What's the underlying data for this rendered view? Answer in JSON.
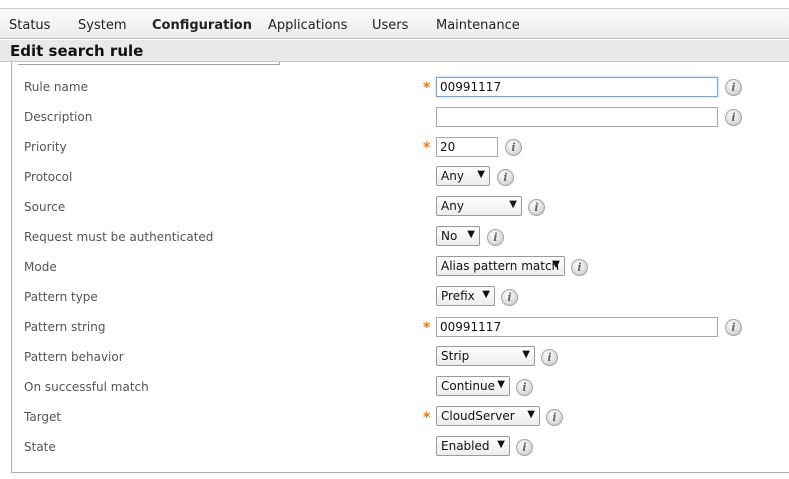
{
  "nav": {
    "items": [
      {
        "label": "Status"
      },
      {
        "label": "System"
      },
      {
        "label": "Configuration"
      },
      {
        "label": "Applications"
      },
      {
        "label": "Users"
      },
      {
        "label": "Maintenance"
      }
    ],
    "active": "Configuration"
  },
  "page": {
    "title": "Edit search rule"
  },
  "icons": {
    "info": "i",
    "required": "*",
    "dropdown": "▼"
  },
  "form": {
    "rule_name": {
      "label": "Rule name",
      "value": "00991117",
      "required": true
    },
    "description": {
      "label": "Description",
      "value": ""
    },
    "priority": {
      "label": "Priority",
      "value": "20",
      "required": true
    },
    "protocol": {
      "label": "Protocol",
      "selected": "Any"
    },
    "source": {
      "label": "Source",
      "selected": "Any"
    },
    "request_auth": {
      "label": "Request must be authenticated",
      "selected": "No"
    },
    "mode": {
      "label": "Mode",
      "selected": "Alias pattern match"
    },
    "pattern_type": {
      "label": "Pattern type",
      "selected": "Prefix"
    },
    "pattern_string": {
      "label": "Pattern string",
      "value": "00991117",
      "required": true
    },
    "pattern_behavior": {
      "label": "Pattern behavior",
      "selected": "Strip"
    },
    "on_success": {
      "label": "On successful match",
      "selected": "Continue"
    },
    "target": {
      "label": "Target",
      "selected": "CloudServer",
      "required": true
    },
    "state": {
      "label": "State",
      "selected": "Enabled"
    }
  },
  "colors": {
    "required_star": "#f07a00",
    "panel_border": "#9fb3c4",
    "focus_border": "#7aa7d6"
  }
}
